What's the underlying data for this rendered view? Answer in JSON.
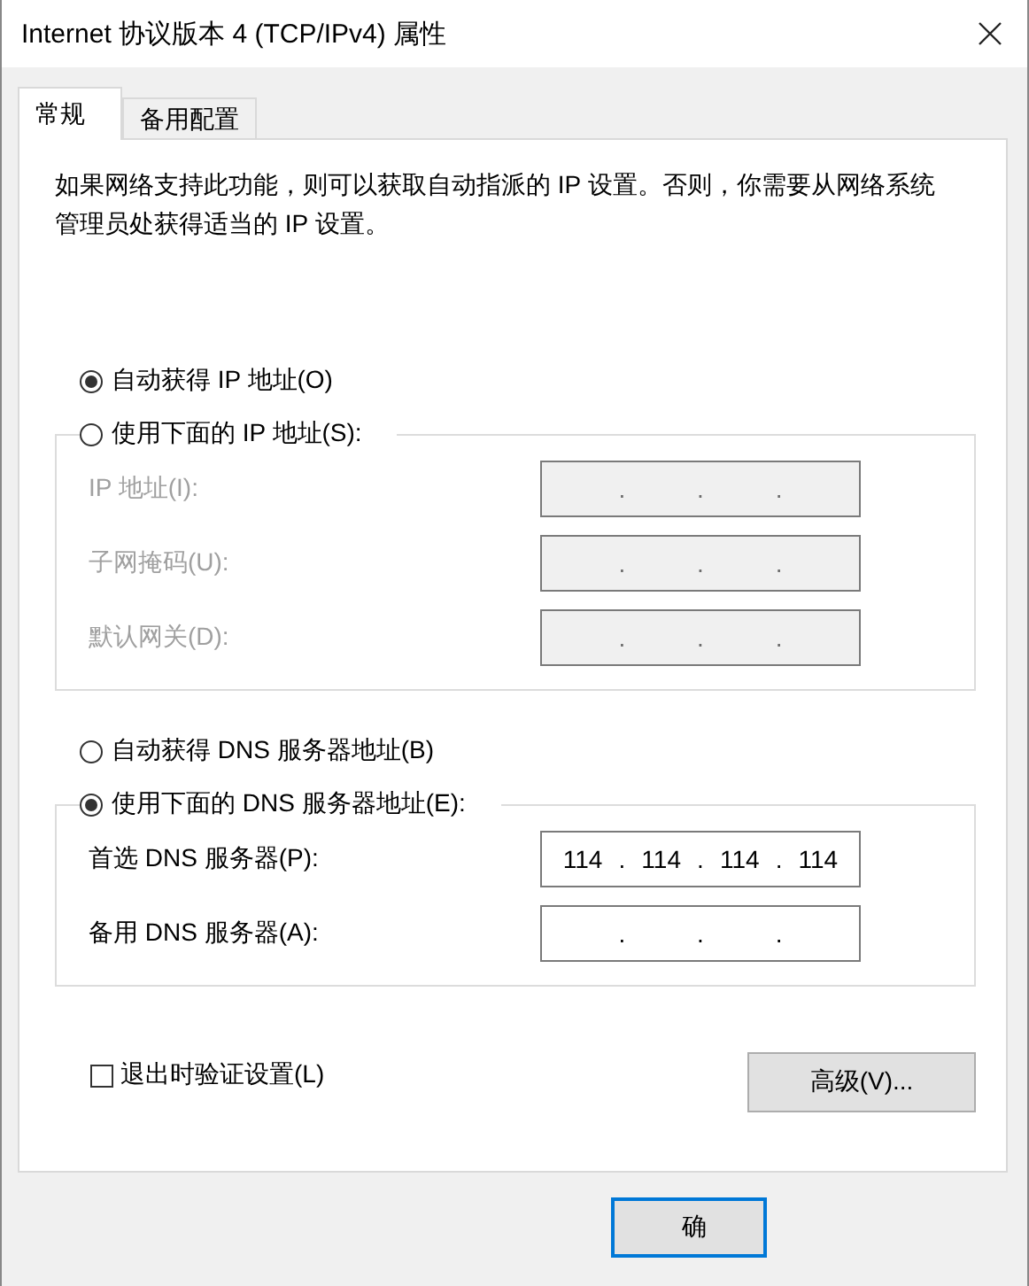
{
  "window": {
    "title": "Internet 协议版本 4 (TCP/IPv4) 属性"
  },
  "tabs": [
    {
      "label": "常规",
      "selected": true
    },
    {
      "label": "备用配置",
      "selected": false
    }
  ],
  "description": "如果网络支持此功能，则可以获取自动指派的 IP 设置。否则，你需要从网络系统管理员处获得适当的 IP 设置。",
  "ip_options": [
    {
      "label": "自动获得 IP 地址(O)",
      "selected": true
    },
    {
      "label": "使用下面的 IP 地址(S):",
      "selected": false
    }
  ],
  "ip_fields": [
    {
      "label": "IP 地址(I):",
      "disabled": true,
      "separators": [
        ".",
        ".",
        "."
      ]
    },
    {
      "label": "子网掩码(U):",
      "disabled": true,
      "separators": [
        ".",
        ".",
        "."
      ]
    },
    {
      "label": "默认网关(D):",
      "disabled": true,
      "separators": [
        ".",
        ".",
        "."
      ]
    }
  ],
  "dns_options": [
    {
      "label": "自动获得 DNS 服务器地址(B)",
      "selected": false
    },
    {
      "label": "使用下面的 DNS 服务器地址(E):",
      "selected": true
    }
  ],
  "dns_fields": [
    {
      "label": "首选 DNS 服务器(P):",
      "disabled": false,
      "octets": [
        "114",
        "114",
        "114",
        "114"
      ],
      "separators": [
        ".",
        ".",
        "."
      ]
    },
    {
      "label": "备用 DNS 服务器(A):",
      "disabled": false,
      "separators": [
        ".",
        ".",
        "."
      ]
    }
  ],
  "validate_checkbox": {
    "label": "退出时验证设置(L)",
    "checked": false
  },
  "advanced_button": "高级(V)...",
  "ok_button": "确"
}
